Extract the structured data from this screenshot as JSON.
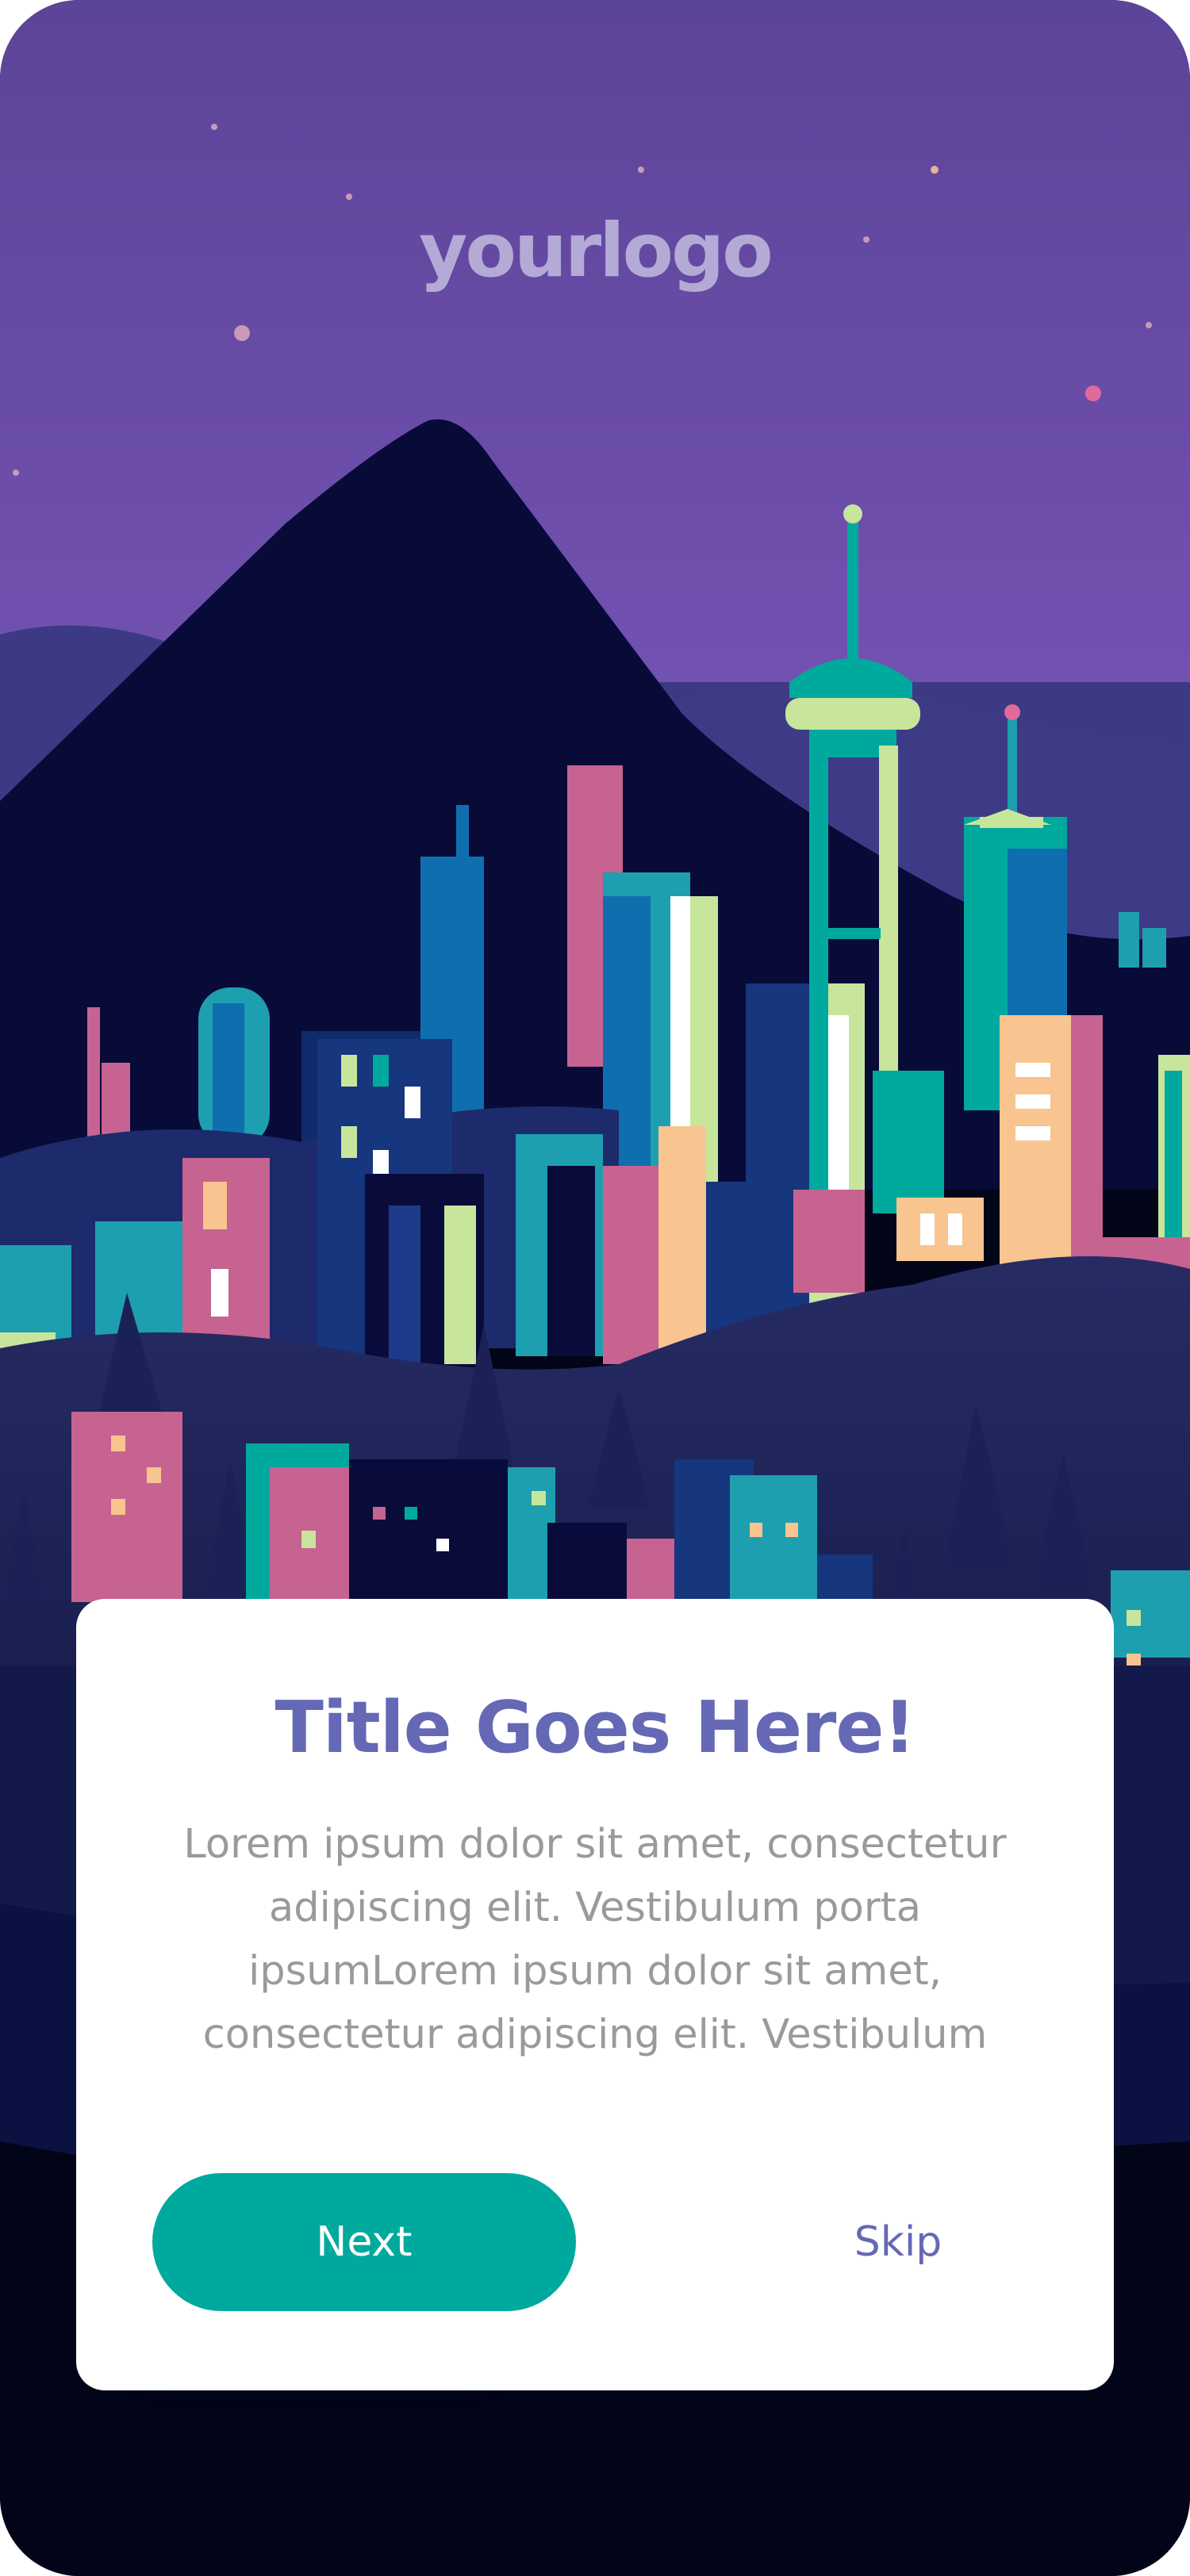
{
  "logo": {
    "text": "yourlogo"
  },
  "card": {
    "title": "Title Goes Here!",
    "body": "Lorem ipsum dolor sit amet, consectetur adipiscing elit. Vestibulum porta ipsumLorem ipsum dolor sit amet, consectetur adipiscing elit. Vestibulum",
    "next_label": "Next",
    "skip_label": "Skip"
  },
  "colors": {
    "sky_top": "#5c4499",
    "sky_bottom": "#7a55b8",
    "mountain": "#090c3a",
    "accent_teal": "#00a99d",
    "title_purple": "#6568b5",
    "body_gray": "#9a9a9a"
  }
}
